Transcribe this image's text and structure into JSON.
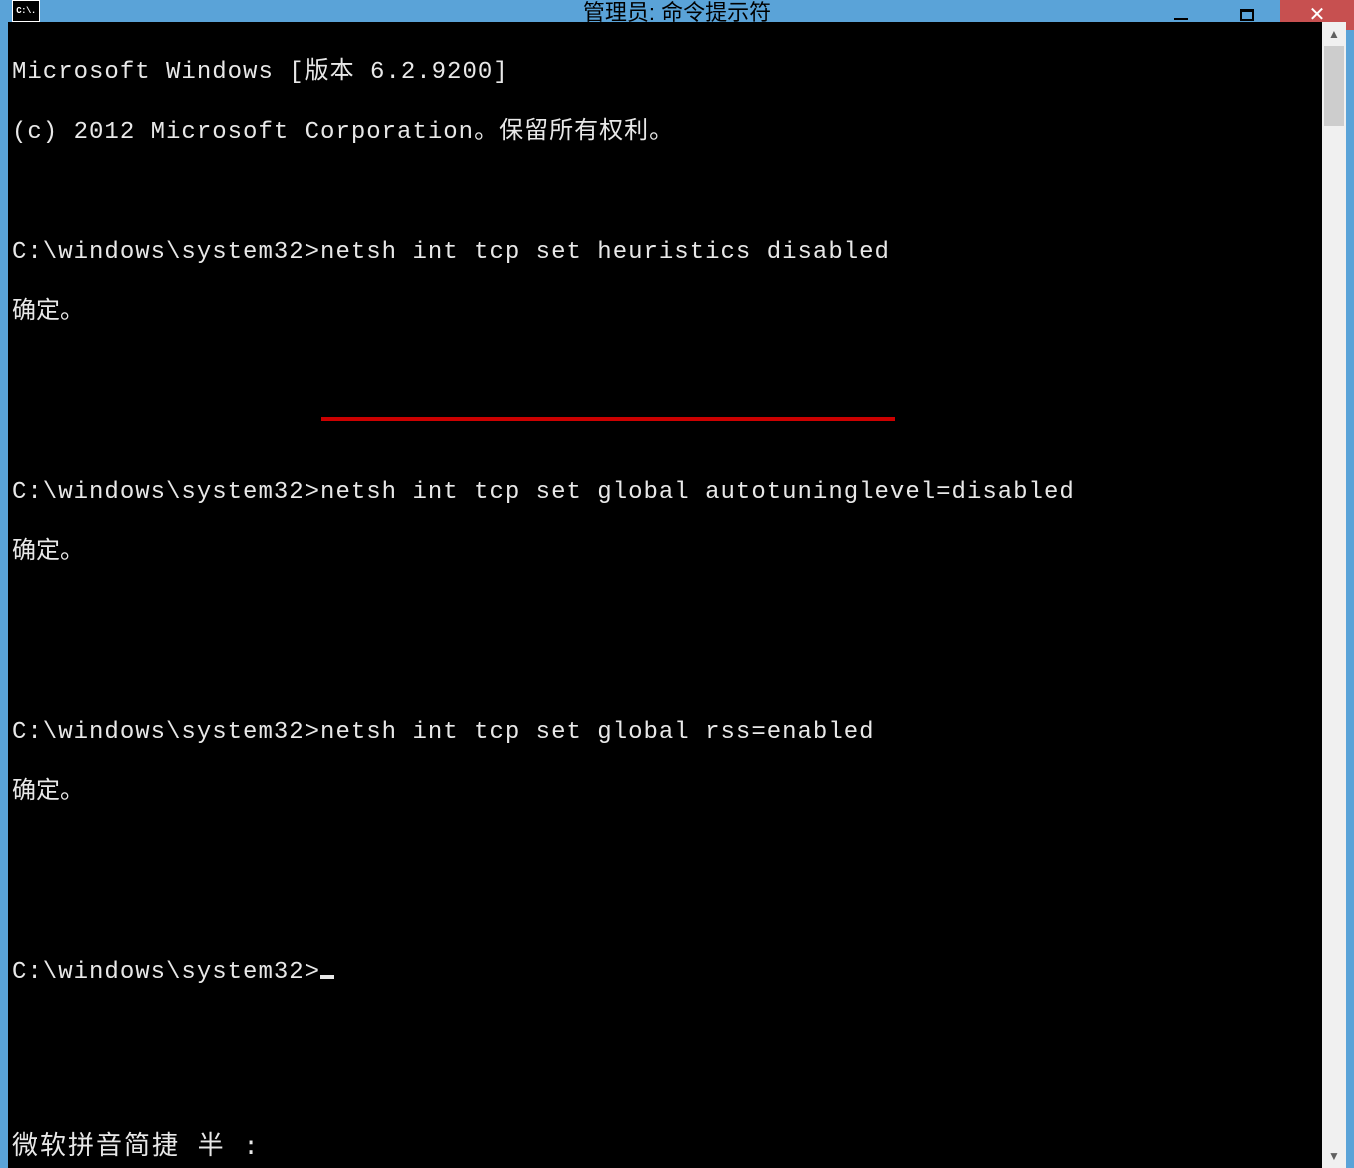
{
  "window": {
    "title": "管理员: 命令提示符",
    "icon_text": "C:\\."
  },
  "console": {
    "header1": "Microsoft Windows [版本 6.2.9200]",
    "header2": "(c) 2012 Microsoft Corporation。保留所有权利。",
    "prompt": "C:\\windows\\system32>",
    "cmd1": "netsh int tcp set heuristics disabled",
    "ok": "确定。",
    "cmd2": "netsh int tcp set global autotuninglevel=disabled",
    "cmd3": "netsh int tcp set global rss=enabled"
  },
  "ime": {
    "status": "微软拼音简捷 半 :"
  },
  "scrollbar": {
    "up": "▲",
    "down": "▼"
  }
}
